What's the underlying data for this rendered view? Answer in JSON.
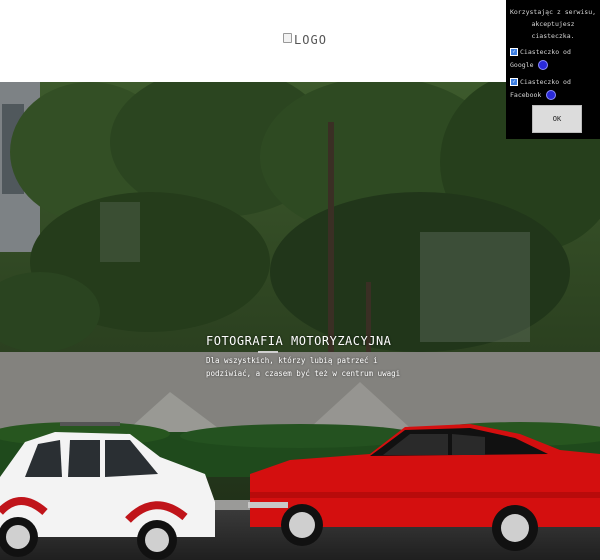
{
  "header": {
    "logo_alt": "LOGO"
  },
  "hero": {
    "title": "FOTOGRAFIA MOTORYZACYJNA",
    "subtitle_line1": "Dla wszystkich, którzy lubią patrzeć i",
    "subtitle_line2": "podziwiać, a czasem być też w centrum uwagi"
  },
  "cookie_banner": {
    "message_line1": "Korzystając z serwisu,",
    "message_line2": "akceptujesz",
    "message_line3": "ciasteczka.",
    "options": [
      {
        "label_line1": "Ciasteczko od",
        "label_line2": "Google",
        "checked": true
      },
      {
        "label_line1": "Ciasteczko od",
        "label_line2": "Facebook",
        "checked": true
      }
    ],
    "ok_label": "OK"
  },
  "colors": {
    "header_bg": "#ffffff",
    "cookie_bg": "#000000",
    "foliage": "#2f4a22",
    "red_car": "#e01212",
    "white_car": "#f4f4f4"
  }
}
